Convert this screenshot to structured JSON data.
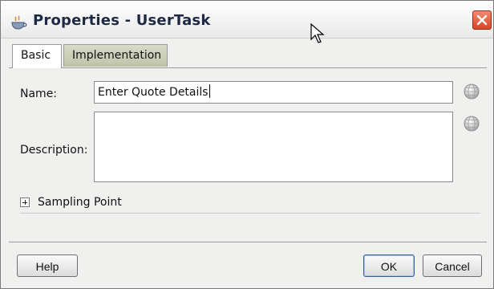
{
  "window": {
    "title": "Properties - UserTask"
  },
  "tabs": [
    {
      "label": "Basic",
      "active": true
    },
    {
      "label": "Implementation",
      "active": false
    }
  ],
  "form": {
    "name_label": "Name:",
    "name_value": "Enter Quote Details",
    "description_label": "Description:",
    "description_value": ""
  },
  "sampling": {
    "label": "Sampling Point",
    "expanded": false
  },
  "footer": {
    "help_label": "Help",
    "ok_label": "OK",
    "cancel_label": "Cancel"
  },
  "icons": {
    "app": "cup-icon",
    "close": "close-icon",
    "translate": "globe-icon",
    "cursor": "mouse-cursor-icon"
  },
  "colors": {
    "close_button": "#d64524",
    "inactive_tab": "#bdc3a7",
    "dialog_bg": "#f0f0ee"
  }
}
